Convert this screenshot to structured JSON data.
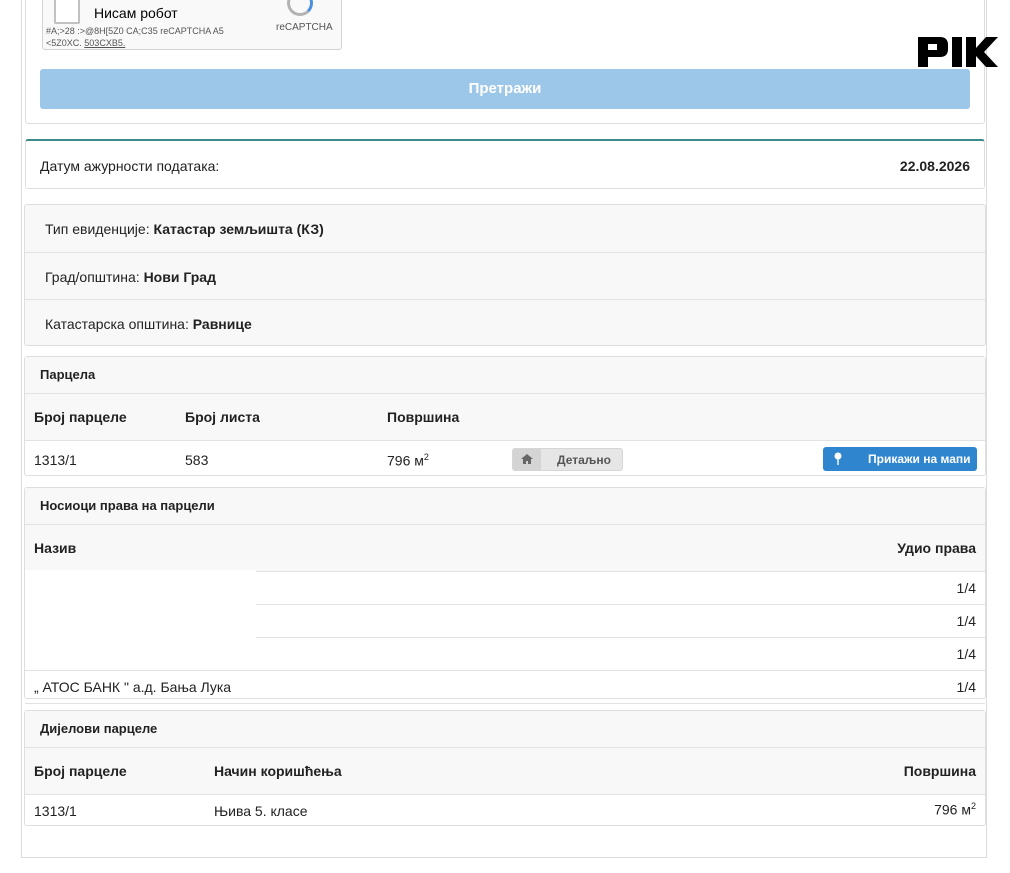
{
  "search": {
    "captcha_label": "Нисам робот",
    "captcha_code": "#A;>28 :>@8H[5Z0 CA;C35 reCAPTCHA A5 <5Z0XC.",
    "captcha_link": "503CXB5.",
    "captcha_brand": "reCAPTCHA",
    "button_label": "Претражи"
  },
  "date_update": {
    "label": "Датум ажурности података:",
    "value": "22.08.2026"
  },
  "info": {
    "record_type_label": "Тип евиденције:",
    "record_type_value": "Катастар земљишта (КЗ)",
    "city_label": "Град/општина:",
    "city_value": "Нови Град",
    "cadastral_label": "Катастарска општина:",
    "cadastral_value": "Равнице"
  },
  "parcel": {
    "title": "Парцела",
    "headers": {
      "number": "Број парцеле",
      "sheet": "Број листа",
      "area": "Површина"
    },
    "row": {
      "number": "1313/1",
      "sheet": "583",
      "area": "796 м",
      "area_exp": "2"
    },
    "detail_label": "Детаљно",
    "map_label": "Прикажи на мапи"
  },
  "owners": {
    "title": "Носиоци права на парцели",
    "headers": {
      "name": "Назив",
      "share": "Удио права"
    },
    "rows": [
      {
        "name": "",
        "share": "1/4"
      },
      {
        "name": "",
        "share": "1/4"
      },
      {
        "name": "",
        "share": "1/4"
      },
      {
        "name": "„ АТОС БАНК \" а.д. Бања Лука",
        "share": "1/4"
      }
    ]
  },
  "parts": {
    "title": "Дијелови парцеле",
    "headers": {
      "number": "Број парцеле",
      "usage": "Начин коришћења",
      "area": "Површина"
    },
    "row": {
      "number": "1313/1",
      "usage": "Њива 5. класе",
      "area": "796 м",
      "area_exp": "2"
    }
  },
  "colors": {
    "accent": "#2f86cf",
    "search_button": "#9cc7e8",
    "card_top_border": "#3c8a8a"
  },
  "icons": {
    "detail": "home-icon",
    "map": "map-pin-icon",
    "logo": "pik-logo"
  }
}
